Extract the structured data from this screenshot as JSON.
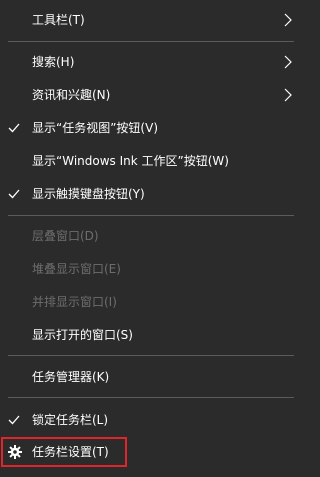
{
  "colors": {
    "background": "#2b2b2b",
    "text": "#ffffff",
    "disabled_text": "#6d6d6d",
    "separator": "#5b5b5b",
    "highlight_box": "#e0262b"
  },
  "menu": {
    "toolbars": "工具栏(T)",
    "search": "搜索(H)",
    "news_interests": "资讯和兴趣(N)",
    "show_task_view": "显示“任务视图”按钮(V)",
    "show_ink_workspace": "显示“Windows Ink 工作区”按钮(W)",
    "show_touch_keyboard": "显示触摸键盘按钮(Y)",
    "cascade": "层叠窗口(D)",
    "stacked": "堆叠显示窗口(E)",
    "side_by_side": "并排显示窗口(I)",
    "show_open_windows": "显示打开的窗口(S)",
    "task_manager": "任务管理器(K)",
    "lock_taskbar": "锁定任务栏(L)",
    "taskbar_settings": "任务栏设置(T)"
  },
  "icons": {
    "check": "checkmark-icon",
    "submenu": "chevron-right-icon",
    "settings": "gear-icon"
  }
}
